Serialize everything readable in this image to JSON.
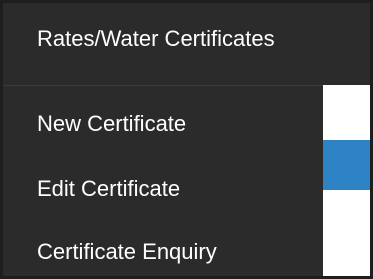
{
  "nav": {
    "title": "Rates/Water Certificates",
    "menu_items": [
      {
        "label": "New Certificate"
      },
      {
        "label": "Edit Certificate"
      },
      {
        "label": "Certificate Enquiry"
      }
    ]
  },
  "colors": {
    "nav_background": "#2b2b2b",
    "nav_text": "#ffffff",
    "content_accent": "#2e83c4",
    "frame_border": "#1e1e1e"
  }
}
